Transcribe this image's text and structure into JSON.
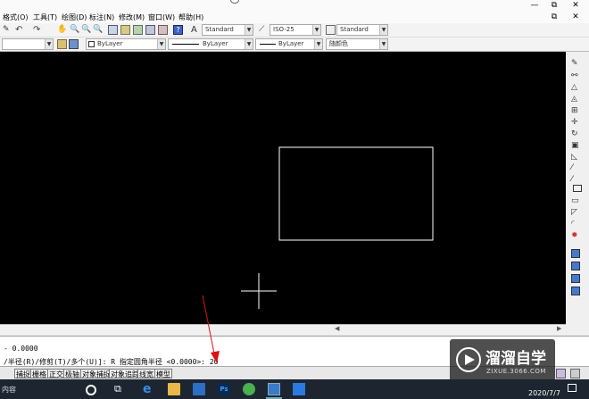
{
  "menubar": {
    "items": [
      "格式(O)",
      "工具(T)",
      "绘图(D)",
      "标注(N)",
      "修改(M)",
      "窗口(W)",
      "帮助(H)"
    ],
    "window_controls": [
      "—",
      "⧉",
      "✕"
    ]
  },
  "toolbar1": {
    "text_style": "Standard",
    "dim_style": "ISO-25",
    "table_style": "Standard"
  },
  "toolbar2": {
    "layer": "ByLayer",
    "linetype": "ByLayer",
    "lineweight": "ByLayer",
    "plot_color": "随颜色"
  },
  "canvas": {
    "background": "#000000",
    "stroke": "#ffffff"
  },
  "command": {
    "line1": "- 0.0000",
    "line2": "/半径(R)/修剪(T)/多个(U)]: R 指定圆角半径 <0.0000>: 20"
  },
  "statusbar": {
    "buttons": [
      "捕捉",
      "栅格",
      "正交",
      "极轴",
      "对象捕捉",
      "对象追踪",
      "线宽",
      "模型"
    ]
  },
  "taskbar": {
    "left_text": "内容",
    "ps_label": "Ps",
    "date": "2020/7/7"
  },
  "watermark": {
    "title": "溜溜自学",
    "url": "ZIXUE.3066.COM"
  },
  "colors": {
    "accent_arrow": "#e01010",
    "taskbar": "#1c2530"
  }
}
